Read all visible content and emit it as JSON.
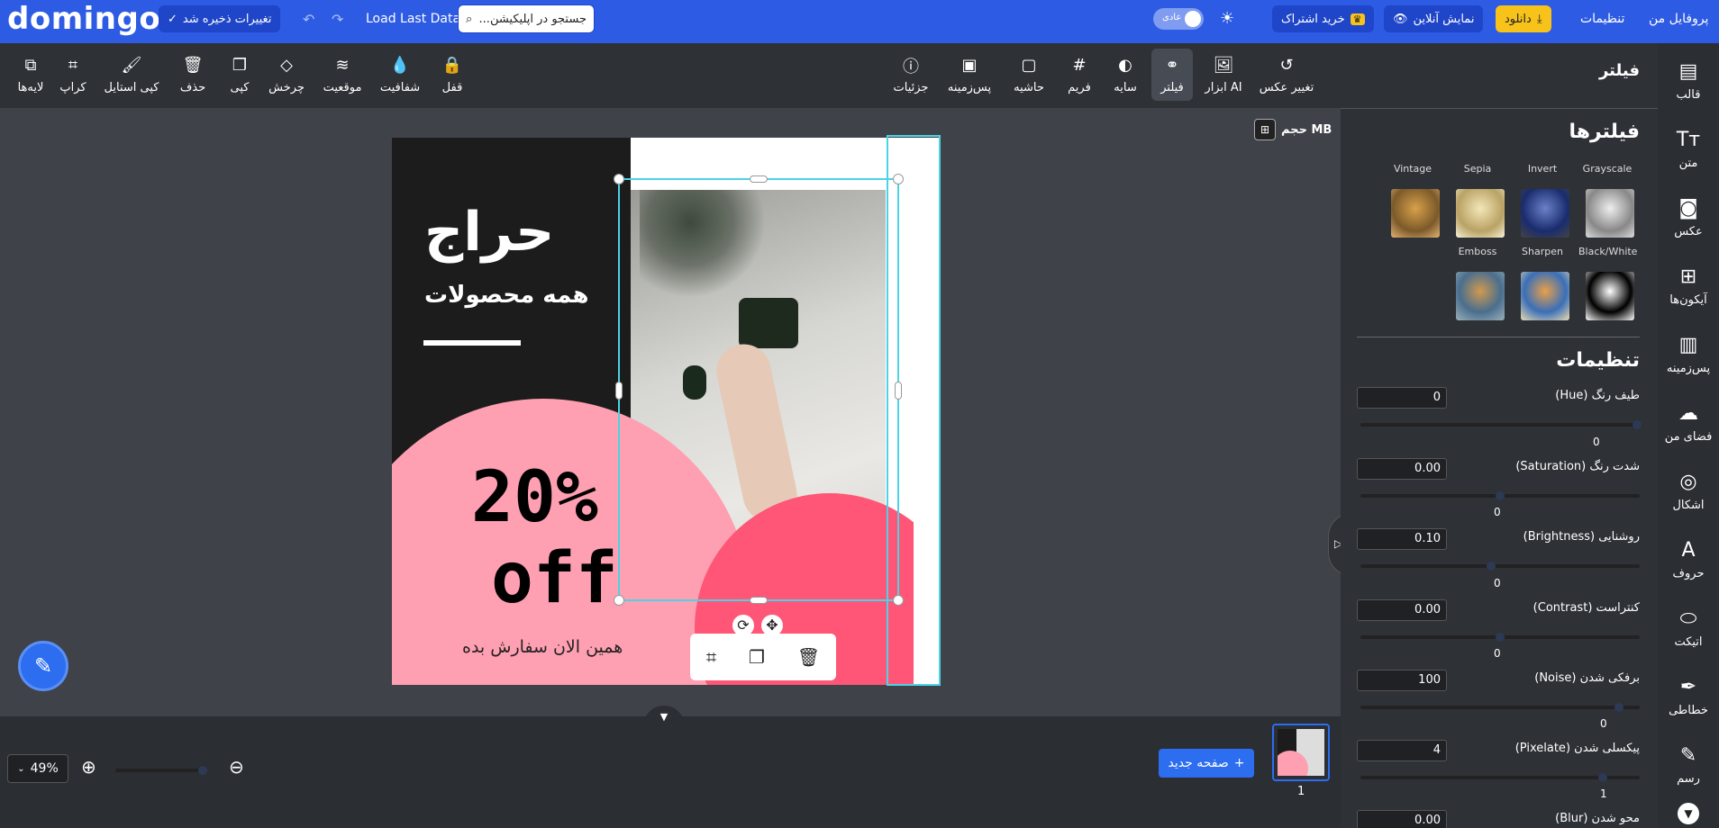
{
  "topbar": {
    "logo": "domingo",
    "saved_label": "تغییرات ذخیره شد",
    "load_last": "Load Last Data",
    "search_placeholder": "جستجو در اپلیکیشن...",
    "mode_label": "عادی",
    "subscribe_label": "خرید اشتراک",
    "online_label": "نمایش آنلاین",
    "download_label": "دانلود",
    "settings_label": "تنظیمات",
    "profile_label": "پروفایل من"
  },
  "toolbar": {
    "layers": "لایه‌ها",
    "crop": "کراپ",
    "copy_style": "کپی استایل",
    "delete": "حذف",
    "copy": "کپی",
    "rotate": "چرخش",
    "position": "موقعیت",
    "opacity": "شفافیت",
    "lock": "قفل",
    "details": "جزئیات",
    "background": "پس‌زمینه",
    "border": "حاشیه",
    "frame": "فریم",
    "shadow": "سایه",
    "filter": "فیلتر",
    "ai_tools": "ابزار AI",
    "change_photo": "تغییر عکس"
  },
  "size_label": "حجم MB",
  "canvas": {
    "sale": "حراج",
    "all_products": "همه محصولات",
    "percent": "20%",
    "off": "off",
    "order_now": "همین الان سفارش بده"
  },
  "bottom": {
    "zoom": "49%",
    "new_page": "صفحه جدید",
    "page_number": "1"
  },
  "panel": {
    "title": "فیلتر",
    "filters_heading": "فیلترها",
    "filters": [
      "Grayscale",
      "Invert",
      "Sepia",
      "Vintage",
      "Black/White",
      "Sharpen",
      "Emboss"
    ],
    "settings_heading": "تنظیمات",
    "settings": [
      {
        "label": "طیف رنگ (Hue)",
        "value": "0",
        "slider": "0"
      },
      {
        "label": "شدت رنگ (Saturation)",
        "value": "0.00",
        "slider": "0"
      },
      {
        "label": "روشنایی (Brightness)",
        "value": "0.10",
        "slider": "0"
      },
      {
        "label": "کنتراست (Contrast)",
        "value": "0.00",
        "slider": "0"
      },
      {
        "label": "برفکی شدن (Noise)",
        "value": "100",
        "slider": "0"
      },
      {
        "label": "پیکسلی شدن (Pixelate)",
        "value": "4",
        "slider": "1"
      },
      {
        "label": "محو شدن (Blur)",
        "value": "0.00",
        "slider": ""
      }
    ]
  },
  "rail": [
    "قالب",
    "متن",
    "عکس",
    "آیکون‌ها",
    "پس‌زمینه",
    "فضای من",
    "اشکال",
    "حروف",
    "اتیکت",
    "خطاطی",
    "رسم"
  ]
}
